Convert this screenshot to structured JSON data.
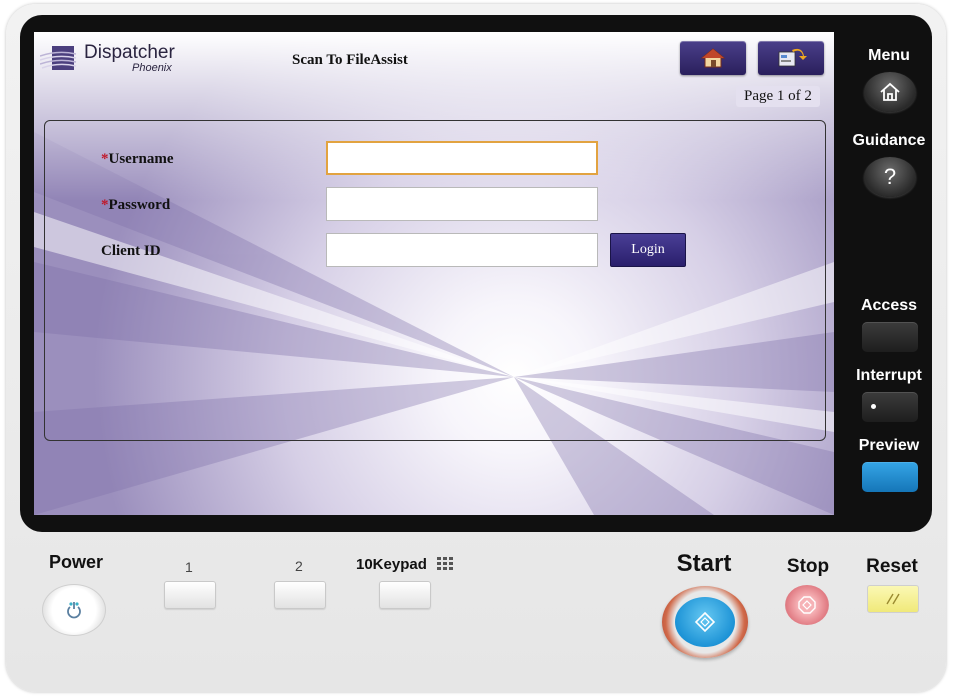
{
  "header": {
    "logo_title": "Dispatcher",
    "logo_subtitle": "Phoenix",
    "page_title": "Scan To FileAssist",
    "page_indicator": "Page 1 of 2"
  },
  "form": {
    "username_required": "*",
    "username_label": "Username",
    "username_value": "",
    "password_required": "*",
    "password_label": "Password",
    "password_value": "",
    "client_id_label": "Client ID",
    "client_id_value": "",
    "login_label": "Login"
  },
  "side_panel": {
    "menu_label": "Menu",
    "guidance_label": "Guidance",
    "guidance_icon": "?",
    "access_label": "Access",
    "interrupt_label": "Interrupt",
    "preview_label": "Preview"
  },
  "hardware": {
    "power_label": "Power",
    "key1_label": "1",
    "key2_label": "2",
    "keypad_label": "10Keypad",
    "start_label": "Start",
    "stop_label": "Stop",
    "reset_label": "Reset"
  },
  "colors": {
    "accent": "#2a1f5c",
    "active_field_border": "#e2a340",
    "required_marker": "#c0182a",
    "preview_key": "#1d8ad0",
    "start_key": "#1d93d6"
  },
  "icons": {
    "home": "home-icon",
    "back": "back-icon",
    "menu": "home-outline-icon",
    "guidance": "question-icon",
    "power": "power-icon",
    "keypad": "keypad-grid-icon",
    "start": "start-diamond-icon",
    "stop": "stop-icon",
    "reset": "reset-slash-icon"
  }
}
